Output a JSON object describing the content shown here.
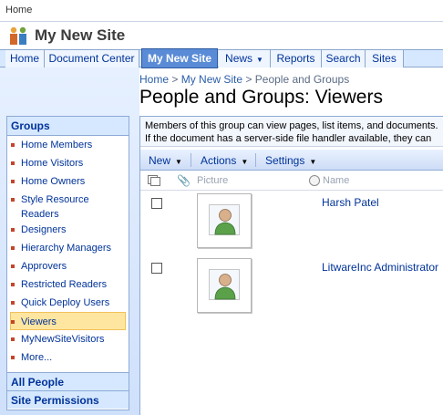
{
  "topbar": {
    "home_link": "Home"
  },
  "site": {
    "title": "My New Site"
  },
  "nav": {
    "tabs": [
      {
        "label": "Home"
      },
      {
        "label": "Document Center"
      },
      {
        "label": "My New Site",
        "active": true
      },
      {
        "label": "News",
        "has_dropdown": true
      },
      {
        "label": "Reports"
      },
      {
        "label": "Search"
      },
      {
        "label": "Sites"
      }
    ]
  },
  "breadcrumb": {
    "items": [
      "Home",
      "My New Site",
      "People and Groups"
    ],
    "separator": ">"
  },
  "page": {
    "title": "People and Groups: Viewers"
  },
  "quicklaunch": {
    "heading": "Groups",
    "items": [
      {
        "label": "Home Members"
      },
      {
        "label": "Home Visitors"
      },
      {
        "label": "Home Owners"
      },
      {
        "label": "Style Resource Readers"
      },
      {
        "label": "Designers"
      },
      {
        "label": "Hierarchy Managers"
      },
      {
        "label": "Approvers"
      },
      {
        "label": "Restricted Readers"
      },
      {
        "label": "Quick Deploy Users"
      },
      {
        "label": "Viewers",
        "selected": true
      },
      {
        "label": "MyNewSiteVisitors"
      },
      {
        "label": "More..."
      }
    ],
    "all_people": "All People",
    "site_permissions": "Site Permissions"
  },
  "description": "Members of this group can view pages, list items, and documents. If the document has a server-side file handler available, they can only view the document using the server rendering.",
  "toolbar": {
    "new_label": "New",
    "actions_label": "Actions",
    "settings_label": "Settings"
  },
  "list": {
    "columns": {
      "picture": "Picture",
      "name": "Name"
    },
    "rows": [
      {
        "name": "Harsh Patel"
      },
      {
        "name": "LitwareInc Administrator"
      }
    ]
  },
  "colors": {
    "accent": "#003399",
    "nav_active": "#5a8bd6",
    "selected": "#ffe6a0",
    "bullet": "#c4452c"
  }
}
